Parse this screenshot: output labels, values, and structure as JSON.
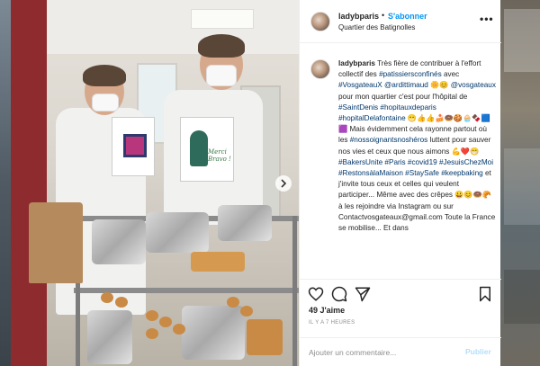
{
  "post": {
    "header": {
      "username": "ladybparis",
      "separator": "•",
      "follow_label": "S'abonner",
      "location": "Quartier des Batignolles",
      "more_icon": "more-horizontal-icon"
    },
    "photo": {
      "card_text": "Merci Bravo !",
      "next_icon": "chevron-right-icon"
    },
    "caption": {
      "username": "ladybparis",
      "segments": [
        {
          "t": "Très fière de contribuer à l'effort collectif des ",
          "tag": false
        },
        {
          "t": "#patissiersconfinés",
          "tag": true
        },
        {
          "t": " avec ",
          "tag": false
        },
        {
          "t": "#VosgateauX @ardittimaud",
          "tag": true
        },
        {
          "t": " 🌼😊 ",
          "tag": false
        },
        {
          "t": "@vosgateaux",
          "tag": true
        },
        {
          "t": " pour mon quartier c'est pour l'hôpital de ",
          "tag": false
        },
        {
          "t": "#SaintDenis #hopitauxdeparis #hopitalDelafontaine",
          "tag": true
        },
        {
          "t": " 😁👍👍🍰🍩🍪🧁🍫🟦🟪 Mais évidemment cela rayonne partout où les ",
          "tag": false
        },
        {
          "t": "#nossoignantsnoshéros",
          "tag": true
        },
        {
          "t": " luttent pour sauver nos vies et ceux que nous aimons 💪❤️😁 ",
          "tag": false
        },
        {
          "t": "#BakersUnite #Paris #covid19 #JesuisChezMoi #RestonsàlaMaison #StaySafe #keepbaking",
          "tag": true
        },
        {
          "t": " et j'invite tous ceux et celles qui veulent participer... Même avec des crêpes 😀😊🍩🥐 à les rejoindre via Instagram ou sur Contactvosgateaux@gmail.com Toute la France se mobilise... Et dans",
          "tag": false
        }
      ]
    },
    "actions": {
      "like_icon": "heart-icon",
      "comment_icon": "comment-icon",
      "share_icon": "share-icon",
      "save_icon": "bookmark-icon"
    },
    "likes": "49 J'aime",
    "time_ago": "IL Y A 7 HEURES",
    "comment": {
      "placeholder": "Ajouter un commentaire...",
      "value": "",
      "publish_label": "Publier"
    }
  },
  "colors": {
    "link_blue": "#0095f6",
    "hashtag": "#00376b",
    "publish_disabled": "#b2dffc"
  }
}
